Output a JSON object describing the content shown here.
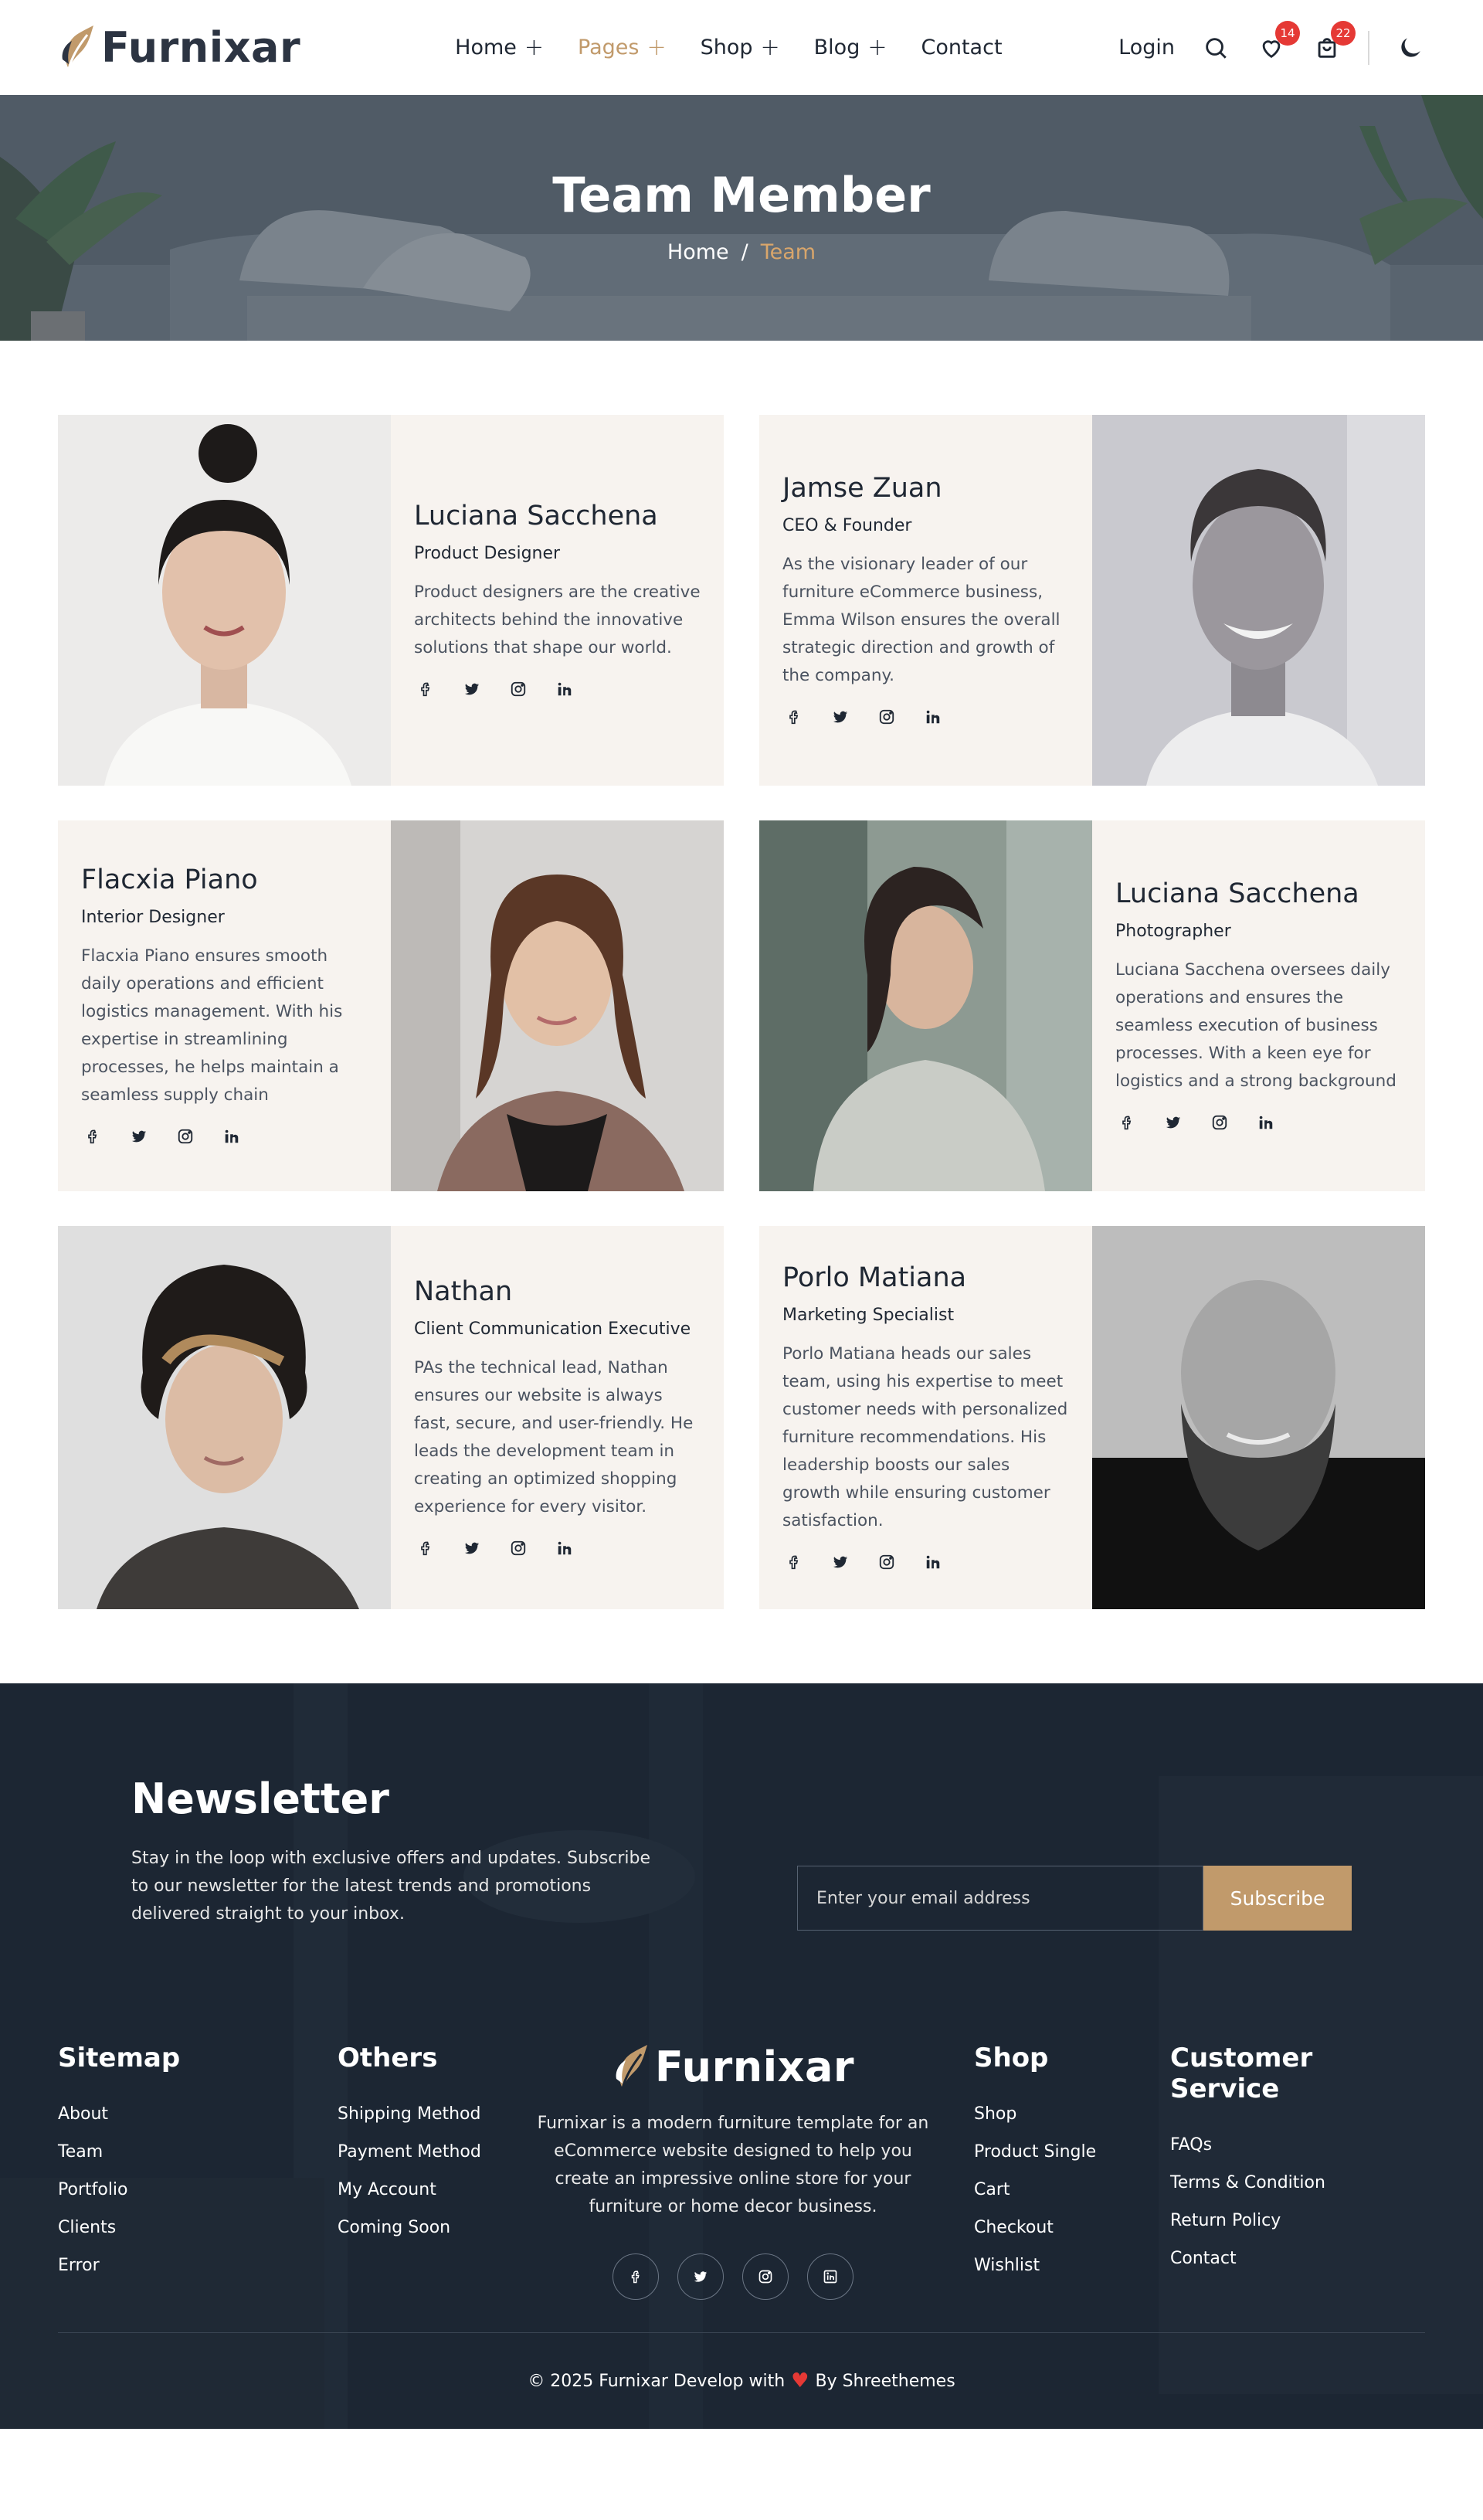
{
  "brand": {
    "name": "Furnixar",
    "accent": "#c19a6b",
    "dark": "#1c2633"
  },
  "nav": {
    "items": [
      {
        "label": "Home",
        "has_submenu": true
      },
      {
        "label": "Pages",
        "has_submenu": true,
        "active": true
      },
      {
        "label": "Shop",
        "has_submenu": true
      },
      {
        "label": "Blog",
        "has_submenu": true
      },
      {
        "label": "Contact",
        "has_submenu": false
      }
    ],
    "login": "Login",
    "wishlist_count": "14",
    "cart_count": "22"
  },
  "hero": {
    "title": "Team Member",
    "breadcrumb": {
      "home": "Home",
      "sep": "/",
      "current": "Team"
    }
  },
  "team": [
    {
      "name": "Luciana Sacchena",
      "role": "Product Designer",
      "bio": "Product designers are the creative architects behind the innovative solutions that shape our world."
    },
    {
      "name": "Jamse Zuan",
      "role": "CEO & Founder",
      "bio": "As the visionary leader of our furniture eCommerce business, Emma Wilson ensures the overall strategic direction and growth of the company."
    },
    {
      "name": "Flacxia Piano",
      "role": "Interior Designer",
      "bio": "Flacxia Piano ensures smooth daily operations and efficient logistics management. With his expertise in streamlining processes, he helps maintain a seamless supply chain"
    },
    {
      "name": "Luciana Sacchena",
      "role": "Photographer",
      "bio": "Luciana Sacchena oversees daily operations and ensures the seamless execution of business processes. With a keen eye for logistics and a strong background"
    },
    {
      "name": "Nathan",
      "role": "Client Communication Executive",
      "bio": "PAs the technical lead, Nathan ensures our website is always fast, secure, and user-friendly. He leads the development team in creating an optimized shopping experience for every visitor."
    },
    {
      "name": "Porlo Matiana",
      "role": "Marketing Specialist",
      "bio": "Porlo Matiana heads our sales team, using his expertise to meet customer needs with personalized furniture recommendations. His leadership boosts our sales growth while ensuring customer satisfaction."
    }
  ],
  "newsletter": {
    "title": "Newsletter",
    "text": "Stay in the loop with exclusive offers and updates. Subscribe to our newsletter for the latest trends and promotions delivered straight to your inbox.",
    "placeholder": "Enter your email address",
    "button": "Subscribe"
  },
  "footer": {
    "sitemap": {
      "title": "Sitemap",
      "links": [
        "About",
        "Team",
        "Portfolio",
        "Clients",
        "Error"
      ]
    },
    "others": {
      "title": "Others",
      "links": [
        "Shipping Method",
        "Payment Method",
        "My Account",
        "Coming Soon"
      ]
    },
    "brand_text": "Furnixar is a modern furniture template for an eCommerce website designed to help you create an impressive online store for your furniture or home decor business.",
    "shop": {
      "title": "Shop",
      "links": [
        "Shop",
        "Product Single",
        "Cart",
        "Checkout",
        "Wishlist"
      ]
    },
    "service": {
      "title": "Customer Service",
      "links": [
        "FAQs",
        "Terms & Condition",
        "Return Policy",
        "Contact"
      ]
    },
    "copyright_pre": "© 2025 Furnixar Develop with",
    "copyright_post": "By Shreethemes"
  }
}
